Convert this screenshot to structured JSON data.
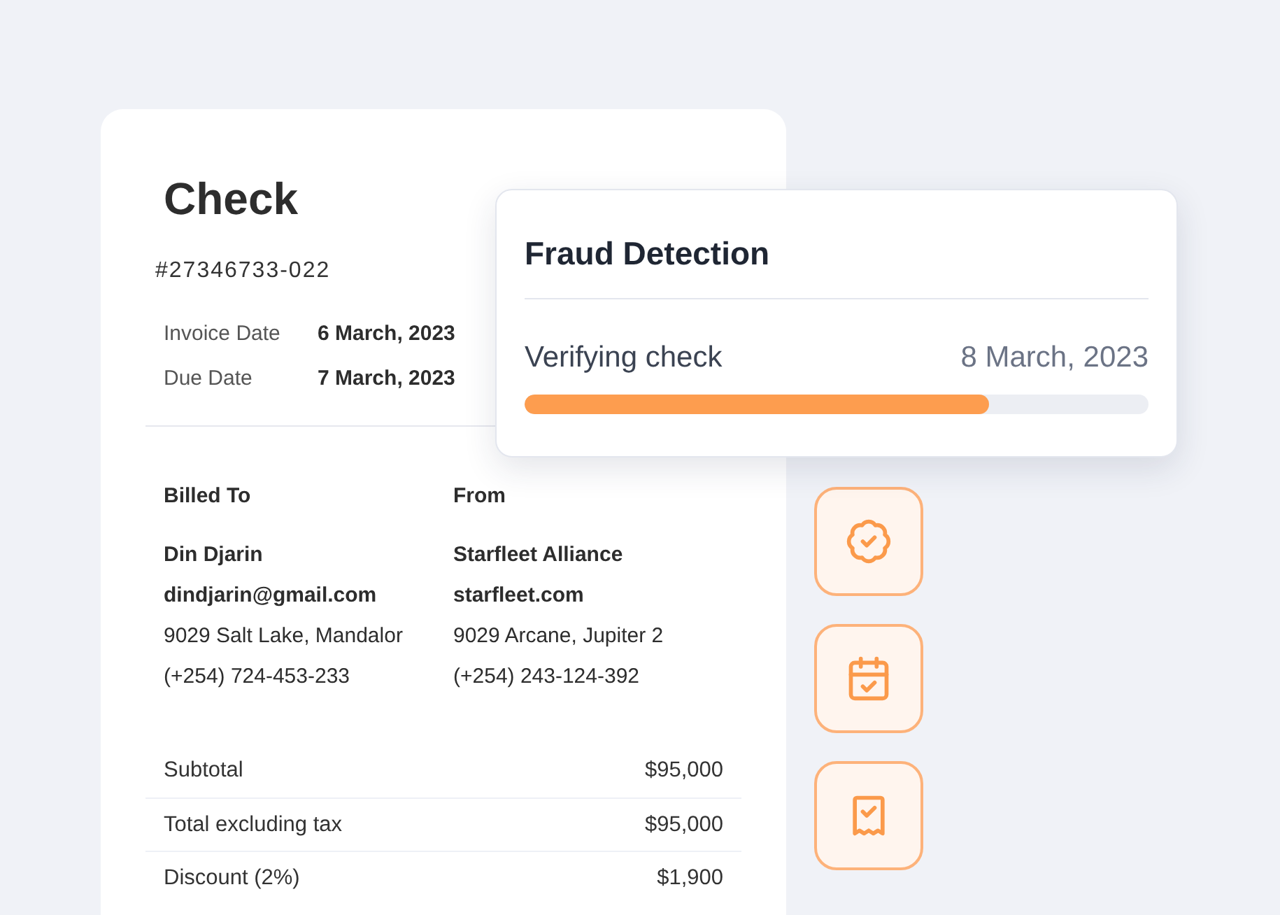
{
  "check": {
    "title": "Check",
    "number": "#27346733-022",
    "dates": [
      {
        "label": "Invoice Date",
        "value": "6 March, 2023"
      },
      {
        "label": "Due Date",
        "value": "7 March, 2023"
      }
    ],
    "parties": [
      {
        "heading": "Billed To",
        "name": "Din Djarin",
        "email": "dindjarin@gmail.com",
        "address": "9029 Salt Lake, Mandalor",
        "phone": "(+254) 724-453-233"
      },
      {
        "heading": "From",
        "name": "Starfleet Alliance",
        "email": "starfleet.com",
        "address": "9029 Arcane, Jupiter 2",
        "phone": "(+254) 243-124-392"
      }
    ],
    "totals": [
      {
        "label": "Subtotal",
        "value": "$95,000"
      },
      {
        "label": "Total excluding tax",
        "value": "$95,000"
      },
      {
        "label": "Discount (2%)",
        "value": "$1,900"
      }
    ]
  },
  "fraud_detection": {
    "title": "Fraud Detection",
    "status": "Verifying check",
    "date": "8 March, 2023",
    "level": 0.745
  },
  "action_icons": [
    {
      "kind": "badge"
    },
    {
      "kind": "calendar"
    },
    {
      "kind": "receipt"
    }
  ]
}
